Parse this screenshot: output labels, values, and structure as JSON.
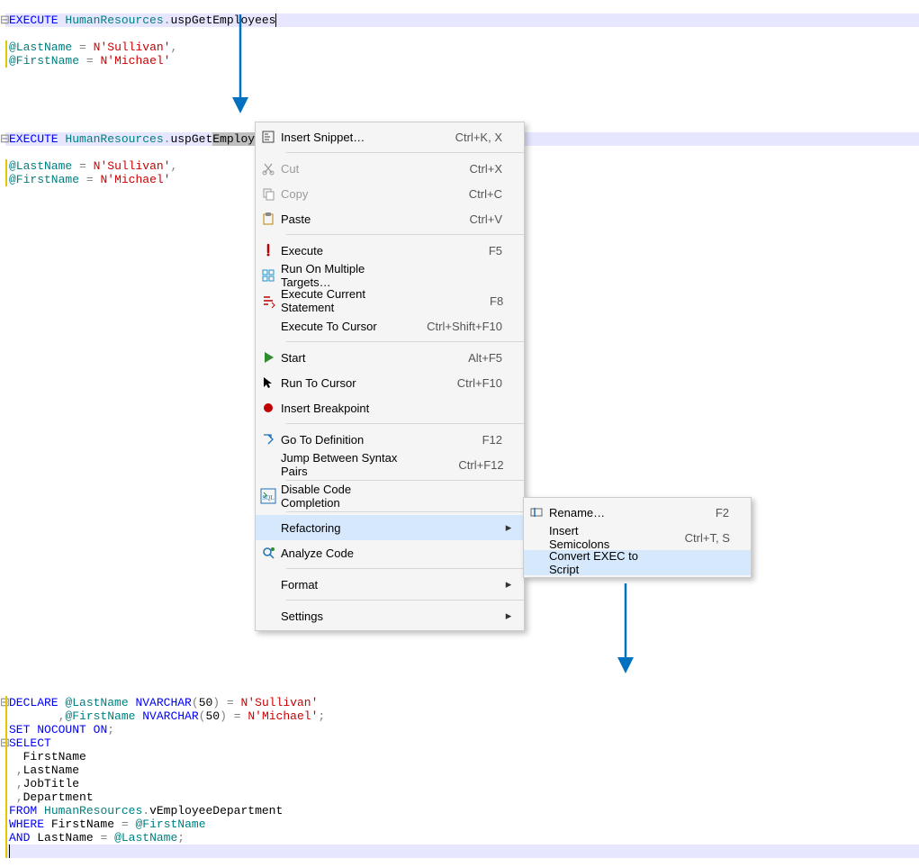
{
  "code": {
    "block1": {
      "kw_execute": "EXECUTE",
      "schema": "HumanResources",
      "proc": "uspGetEmployees",
      "line2_var": "@LastName",
      "line2_eq": "=",
      "line2_prefix": "N",
      "line2_str": "'Sullivan'",
      "line2_comma": ",",
      "line3_var": "@FirstName",
      "line3_eq": "=",
      "line3_prefix": "N",
      "line3_str": "'Michael'"
    },
    "block2": {
      "kw_execute": "EXECUTE",
      "schema": "HumanResources",
      "proc_left": "uspGet",
      "proc_sel": "Employees",
      "line2_var": "@LastName",
      "line2_eq": "=",
      "line2_prefix": "N",
      "line2_str": "'Sullivan'",
      "line2_comma": ",",
      "line3_var": "@FirstName",
      "line3_eq": "=",
      "line3_prefix": "N",
      "line3_str": "'Michael'"
    },
    "block3": {
      "kw_declare": "DECLARE",
      "var_ln": "@LastName",
      "ty_nvarchar1": "NVARCHAR",
      "lp1": "(",
      "size1": "50",
      "rp1": ")",
      "eq1": "=",
      "np1": "N",
      "str1": "'Sullivan'",
      "comma_line": ",",
      "var_fn": "@FirstName",
      "ty_nvarchar2": "NVARCHAR",
      "lp2": "(",
      "size2": "50",
      "rp2": ")",
      "eq2": "=",
      "np2": "N",
      "str2": "'Michael'",
      "semi1": ";",
      "set": "SET",
      "nocount": "NOCOUNT",
      "on": "ON",
      "semi2": ";",
      "select": "SELECT",
      "col1": "FirstName",
      "col_c1": ",",
      "col2": "LastName",
      "col_c2": ",",
      "col3": "JobTitle",
      "col_c3": ",",
      "col4": "Department",
      "from": "FROM",
      "schema3": "HumanResources",
      "dot3": ".",
      "view": "vEmployeeDepartment",
      "where": "WHERE",
      "wcol1": "FirstName",
      "weq1": "=",
      "wvar1": "@FirstName",
      "and": "AND",
      "wcol2": "LastName",
      "weq2": "=",
      "wvar2": "@LastName",
      "semi3": ";"
    }
  },
  "menu_main": {
    "items": [
      {
        "id": "insert-snippet",
        "label": "Insert Snippet…",
        "shortcut": "Ctrl+K, X",
        "icon": "snippet",
        "enabled": true
      },
      {
        "sep": true
      },
      {
        "id": "cut",
        "label": "Cut",
        "shortcut": "Ctrl+X",
        "icon": "cut",
        "enabled": false
      },
      {
        "id": "copy",
        "label": "Copy",
        "shortcut": "Ctrl+C",
        "icon": "copy",
        "enabled": false
      },
      {
        "id": "paste",
        "label": "Paste",
        "shortcut": "Ctrl+V",
        "icon": "paste",
        "enabled": true
      },
      {
        "sep": true
      },
      {
        "id": "execute",
        "label": "Execute",
        "shortcut": "F5",
        "icon": "bang",
        "enabled": true
      },
      {
        "id": "run-multi",
        "label": "Run On Multiple Targets…",
        "shortcut": "",
        "icon": "targets",
        "enabled": true
      },
      {
        "id": "exec-current",
        "label": "Execute Current Statement",
        "shortcut": "F8",
        "icon": "exec-cur",
        "enabled": true
      },
      {
        "id": "exec-to-cursor",
        "label": "Execute To Cursor",
        "shortcut": "Ctrl+Shift+F10",
        "icon": "",
        "enabled": true
      },
      {
        "sep": true
      },
      {
        "id": "start",
        "label": "Start",
        "shortcut": "Alt+F5",
        "icon": "play",
        "enabled": true
      },
      {
        "id": "run-to-cursor",
        "label": "Run To Cursor",
        "shortcut": "Ctrl+F10",
        "icon": "pointer",
        "enabled": true
      },
      {
        "id": "insert-bp",
        "label": "Insert Breakpoint",
        "shortcut": "",
        "icon": "bp",
        "enabled": true
      },
      {
        "sep": true
      },
      {
        "id": "goto-def",
        "label": "Go To Definition",
        "shortcut": "F12",
        "icon": "goto",
        "enabled": true
      },
      {
        "id": "jump-syntax",
        "label": "Jump Between Syntax Pairs",
        "shortcut": "Ctrl+F12",
        "icon": "",
        "enabled": true
      },
      {
        "sep": true
      },
      {
        "id": "disable-cc",
        "label": "Disable Code Completion",
        "shortcut": "",
        "icon": "sql",
        "enabled": true
      },
      {
        "sep": true
      },
      {
        "id": "refactoring",
        "label": "Refactoring",
        "shortcut": "",
        "icon": "",
        "enabled": true,
        "sub": true,
        "hl": true
      },
      {
        "id": "analyze",
        "label": "Analyze Code",
        "shortcut": "",
        "icon": "analyze",
        "enabled": true
      },
      {
        "sep": true
      },
      {
        "id": "format",
        "label": "Format",
        "shortcut": "",
        "icon": "",
        "enabled": true,
        "sub": true
      },
      {
        "sep": true
      },
      {
        "id": "settings",
        "label": "Settings",
        "shortcut": "",
        "icon": "",
        "enabled": true,
        "sub": true
      }
    ]
  },
  "menu_sub": {
    "items": [
      {
        "id": "rename",
        "label": "Rename…",
        "shortcut": "F2",
        "icon": "rename",
        "enabled": true
      },
      {
        "id": "insert-semi",
        "label": "Insert Semicolons",
        "shortcut": "Ctrl+T, S",
        "icon": "",
        "enabled": true
      },
      {
        "id": "convert-exec",
        "label": "Convert EXEC to Script",
        "shortcut": "",
        "icon": "",
        "enabled": true,
        "hl": true
      }
    ]
  }
}
